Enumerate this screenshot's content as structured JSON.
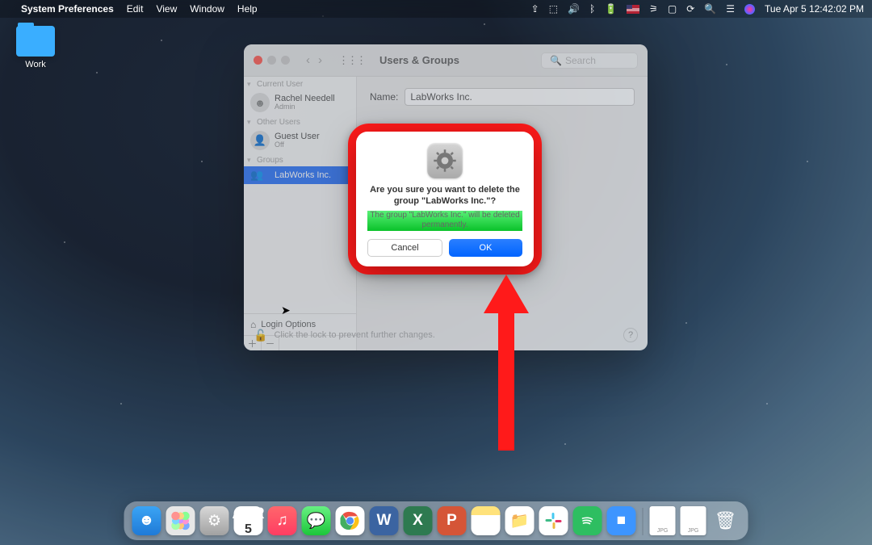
{
  "menubar": {
    "app": "System Preferences",
    "menus": [
      "Edit",
      "View",
      "Window",
      "Help"
    ],
    "clock": "Tue Apr 5  12:42:02 PM"
  },
  "desktop": {
    "folder_label": "Work"
  },
  "window": {
    "title": "Users & Groups",
    "search_placeholder": "Search",
    "sidebar": {
      "current_user_label": "Current User",
      "current_user": {
        "name": "Rachel Needell",
        "role": "Admin"
      },
      "other_users_label": "Other Users",
      "other_user": {
        "name": "Guest User",
        "role": "Off"
      },
      "groups_label": "Groups",
      "group": {
        "name": "LabWorks Inc."
      },
      "login_options": "Login Options"
    },
    "content": {
      "name_label": "Name:",
      "name_value": "LabWorks Inc."
    },
    "lock_hint": "Click the lock to prevent further changes."
  },
  "dialog": {
    "title": "Are you sure you want to delete the group \"LabWorks Inc.\"?",
    "message": "The group \"LabWorks Inc.\" will be deleted permanently.",
    "cancel": "Cancel",
    "ok": "OK"
  },
  "dock": {
    "calendar": {
      "month": "APR",
      "day": "5"
    },
    "word": "W",
    "excel": "X",
    "ppt": "P",
    "file1": "JPG",
    "file2": "JPG"
  }
}
